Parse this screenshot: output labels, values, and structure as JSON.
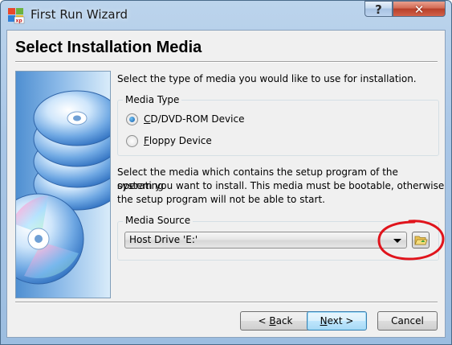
{
  "window": {
    "title": "First Run Wizard"
  },
  "title_bar": {
    "help_glyph": "?",
    "close_glyph": "✕"
  },
  "header": {
    "title": "Select Installation Media"
  },
  "intro_text": "Select the type of media you would like to use for installation.",
  "media_type": {
    "title": "Media Type",
    "options": [
      {
        "mnemonic": "C",
        "rest": "D/DVD-ROM Device",
        "checked": true
      },
      {
        "mnemonic": "F",
        "rest": "loppy Device",
        "checked": false
      }
    ]
  },
  "description": {
    "line1": "Select the media which contains the setup program of the operating",
    "line2": "system you want to install. This media must be bootable, otherwise",
    "line3": "the setup program will not be able to start."
  },
  "media_source": {
    "title": "Media Source",
    "selected": "Host Drive 'E:'",
    "browse_icon": "folder-open-icon"
  },
  "buttons": {
    "back": {
      "prefix": "< ",
      "mnemonic": "B",
      "rest": "ack"
    },
    "next": {
      "mnemonic": "N",
      "rest": "ext >"
    },
    "cancel": {
      "label": "Cancel"
    }
  },
  "colors": {
    "annotation": "#e0141c",
    "accent": "#3c7fb1"
  }
}
